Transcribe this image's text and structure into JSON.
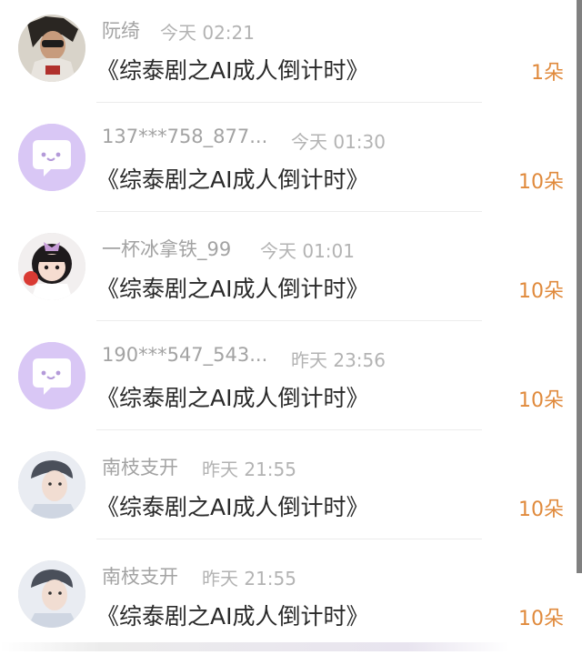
{
  "messages": [
    {
      "name": "阮绮",
      "time": "今天 02:21",
      "title": "《综泰剧之AI成人倒计时》",
      "count": "1朵",
      "avatar_icon": "photo-avatar"
    },
    {
      "name": "137***758_877...",
      "time": "今天 01:30",
      "title": "《综泰剧之AI成人倒计时》",
      "count": "10朵",
      "avatar_icon": "default-chat-bubble-avatar"
    },
    {
      "name": "一杯冰拿铁_99",
      "time": "今天 01:01",
      "title": "《综泰剧之AI成人倒计时》",
      "count": "10朵",
      "avatar_icon": "cartoon-girl-avatar"
    },
    {
      "name": "190***547_543...",
      "time": "昨天 23:56",
      "title": "《综泰剧之AI成人倒计时》",
      "count": "10朵",
      "avatar_icon": "default-chat-bubble-avatar"
    },
    {
      "name": "南枝支开",
      "time": "昨天 21:55",
      "title": "《综泰剧之AI成人倒计时》",
      "count": "10朵",
      "avatar_icon": "photo-avatar"
    },
    {
      "name": "南枝支开",
      "time": "昨天 21:55",
      "title": "《综泰剧之AI成人倒计时》",
      "count": "10朵",
      "avatar_icon": "photo-avatar"
    }
  ],
  "colors": {
    "accent_count": "#e08a3c",
    "default_avatar_bg": "#d9c7f5",
    "name_text": "#a3a3a3",
    "title_text": "#2a2a2a"
  }
}
